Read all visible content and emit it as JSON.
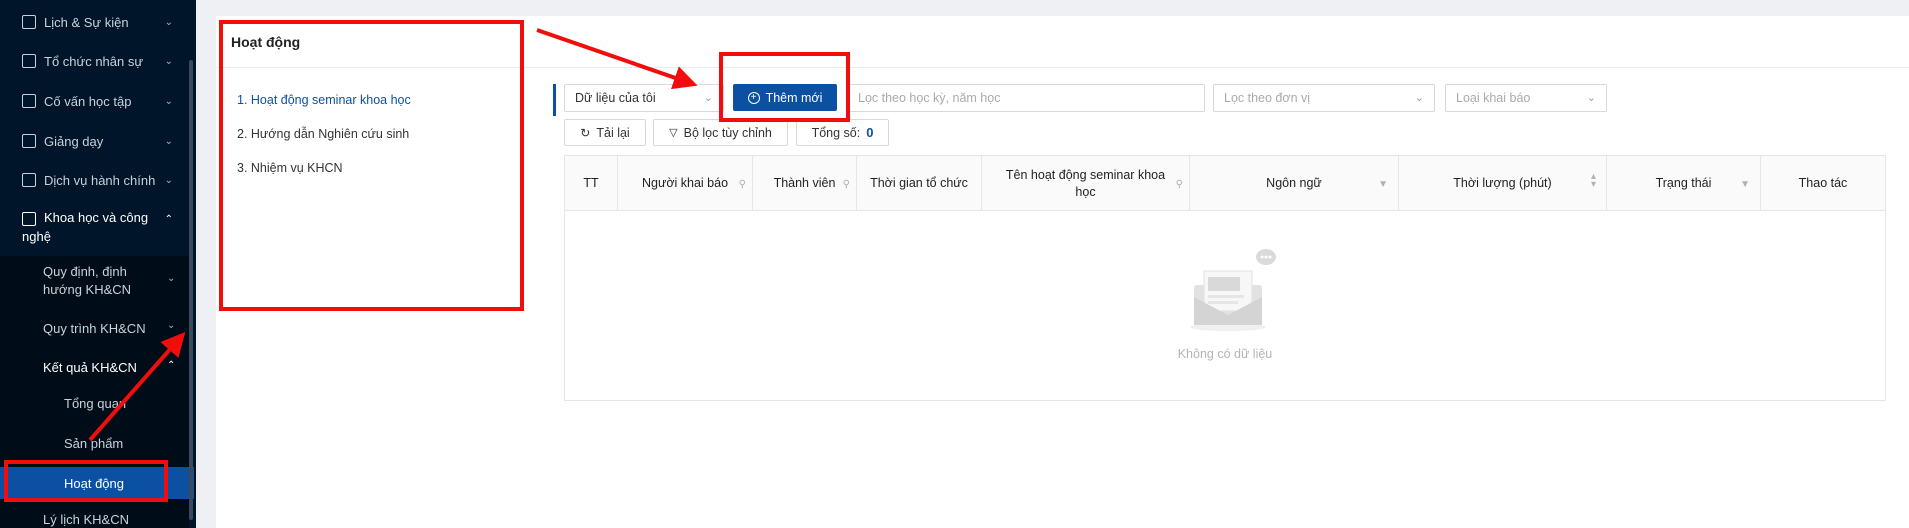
{
  "sidebar": {
    "items": [
      {
        "label": "Lịch & Sự kiện",
        "icon": "calendar-icon"
      },
      {
        "label": "Tổ chức nhân sự",
        "icon": "id-card-icon"
      },
      {
        "label": "Cố vấn học tập",
        "icon": "check-square-icon"
      },
      {
        "label": "Giảng dạy",
        "icon": "presentation-icon"
      },
      {
        "label": "Dịch vụ hành chính",
        "icon": "document-icon"
      },
      {
        "label_line1": "Khoa học và công",
        "label_line2": "nghệ",
        "icon": "chart-icon"
      }
    ],
    "sub_items": [
      {
        "label_line1": "Quy định, định",
        "label_line2": "hướng KH&CN"
      },
      {
        "label": "Quy trình KH&CN"
      },
      {
        "label": "Kết quả KH&CN"
      }
    ],
    "result_children": [
      "Tổng quan",
      "Sản phẩm",
      "Hoạt động"
    ],
    "bottom_item": "Lý lịch KH&CN"
  },
  "main": {
    "title": "Hoạt động",
    "menu": [
      "1. Hoạt động seminar khoa học",
      "2. Hướng dẫn Nghiên cứu sinh",
      "3. Nhiệm vụ KHCN"
    ],
    "filters": {
      "data_scope": "Dữ liệu của tôi",
      "term_placeholder": "Lọc theo học kỳ, năm học",
      "unit_placeholder": "Lọc theo đơn vị",
      "type_placeholder": "Loại khai báo"
    },
    "buttons": {
      "add": "Thêm mới",
      "reload": "Tải lại",
      "custom_filter": "Bộ lọc tùy chỉnh",
      "total_label": "Tổng số:",
      "total_value": "0"
    },
    "table": {
      "columns": {
        "tt": "TT",
        "declarer": "Người khai báo",
        "member": "Thành viên",
        "time": "Thời gian tổ chức",
        "name_line1": "Tên hoạt động seminar khoa",
        "name_line2": "học",
        "language": "Ngôn ngữ",
        "duration": "Thời lượng (phút)",
        "status": "Trạng thái",
        "actions": "Thao tác"
      },
      "empty_text": "Không có dữ liệu"
    }
  },
  "colors": {
    "sidebar_bg": "#001529",
    "primary": "#0b50a3",
    "annotation_red": "#f20d0d"
  }
}
